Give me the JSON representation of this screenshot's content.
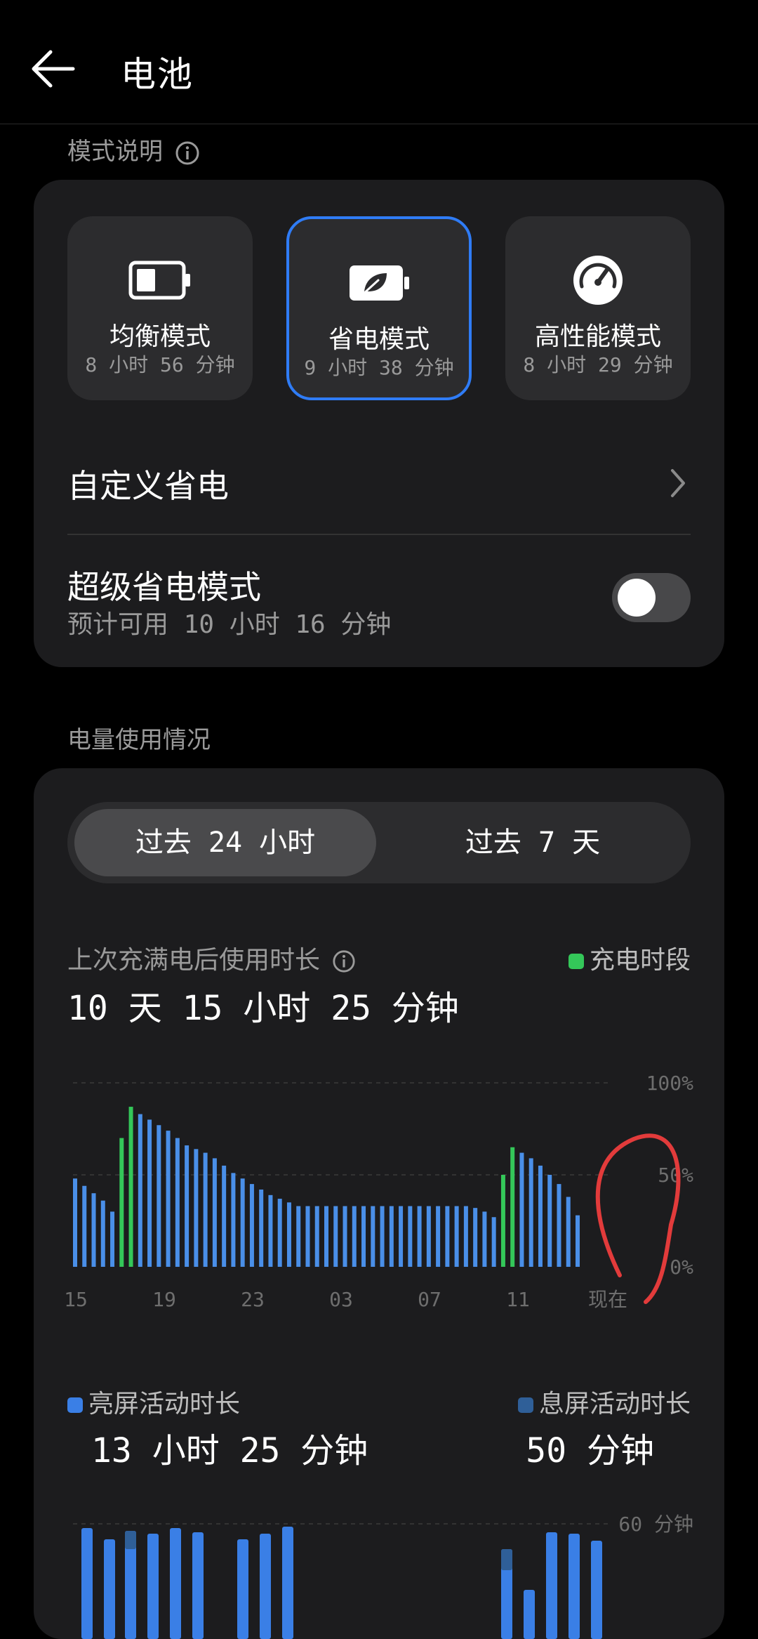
{
  "header": {
    "title": "电池"
  },
  "mode_section": {
    "label": "模式说明"
  },
  "modes": [
    {
      "name": "均衡模式",
      "time": "8 小时 56 分钟",
      "selected": false,
      "icon": "battery-icon"
    },
    {
      "name": "省电模式",
      "time": "9 小时 38 分钟",
      "selected": true,
      "icon": "battery-leaf-icon"
    },
    {
      "name": "高性能模式",
      "time": "8 小时 29 分钟",
      "selected": false,
      "icon": "speedometer-icon"
    }
  ],
  "custom_saver": {
    "label": "自定义省电"
  },
  "super_saver": {
    "label": "超级省电模式",
    "sub": "预计可用 10 小时 16 分钟",
    "enabled": false
  },
  "usage_section": {
    "label": "电量使用情况"
  },
  "tabs": {
    "day": "过去 24 小时",
    "week": "过去 7 天",
    "active": "day"
  },
  "since_charge": {
    "label": "上次充满电后使用时长",
    "value": "10 天 15 小时 25 分钟"
  },
  "charge_legend": {
    "label": "充电时段",
    "color": "#34c759"
  },
  "colors": {
    "accent": "#2f7cf6",
    "battery_bar": "#4a8fe8",
    "charging_bar": "#34c759",
    "screen_on": "#3a7fe6",
    "screen_off": "#2f5f98",
    "annotation": "#e23b3b"
  },
  "chart_data": {
    "type": "bar",
    "title": "",
    "ylim": [
      0,
      100
    ],
    "y_ticks": [
      "100%",
      "50%",
      "0%"
    ],
    "x_ticks": [
      "15",
      "19",
      "23",
      "03",
      "07",
      "11",
      "现在"
    ],
    "values": [
      48,
      44,
      40,
      36,
      30,
      70,
      87,
      83,
      80,
      77,
      74,
      70,
      66,
      64,
      62,
      59,
      55,
      51,
      48,
      45,
      42,
      39,
      37,
      35,
      33,
      33,
      33,
      33,
      33,
      33,
      33,
      33,
      33,
      33,
      33,
      33,
      33,
      33,
      33,
      33,
      33,
      33,
      33,
      32,
      30,
      27,
      50,
      65,
      62,
      59,
      55,
      50,
      45,
      38,
      28
    ],
    "charging": [
      false,
      false,
      false,
      false,
      false,
      true,
      true,
      false,
      false,
      false,
      false,
      false,
      false,
      false,
      false,
      false,
      false,
      false,
      false,
      false,
      false,
      false,
      false,
      false,
      false,
      false,
      false,
      false,
      false,
      false,
      false,
      false,
      false,
      false,
      false,
      false,
      false,
      false,
      false,
      false,
      false,
      false,
      false,
      false,
      false,
      false,
      true,
      true,
      false,
      false,
      false,
      false,
      false,
      false,
      false
    ]
  },
  "screen_usage": {
    "on_label": "亮屏活动时长",
    "on_value": "13 小时 25 分钟",
    "off_label": "息屏活动时长",
    "off_value": "50 分钟",
    "y_top": "60 分钟"
  }
}
